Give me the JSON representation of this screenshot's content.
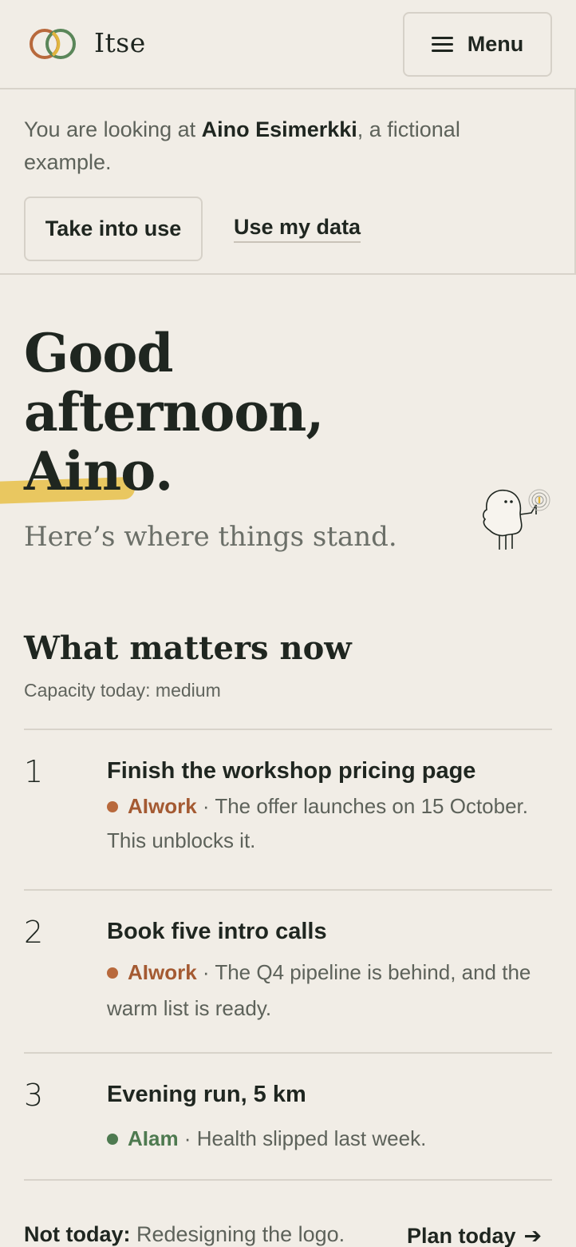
{
  "header": {
    "brand": "Itse",
    "menu_label": "Menu"
  },
  "banner": {
    "text_prefix": "You are looking at ",
    "person_name": "Aino Esimerkki",
    "text_suffix": ", a fictional example.",
    "take_into_use_label": "Take into use",
    "use_my_data_label": "Use my data"
  },
  "greeting": {
    "line1": "Good",
    "line2": "afternoon,",
    "name": "Aino",
    "punct": ".",
    "subtitle": "Here’s where things stand."
  },
  "priorities": {
    "title": "What matters now",
    "capacity": "Capacity today: medium",
    "items": [
      {
        "number": "1",
        "title": "Finish the workshop pricing page",
        "tag": "AIwork",
        "separator": " · ",
        "note": "The offer launches on 15 October. This unblocks it.",
        "color": "#a45a32"
      },
      {
        "number": "2",
        "title": "Book five intro calls",
        "tag": "AIwork",
        "separator": " · ",
        "note": "The Q4 pipeline is behind, and the warm list is ready.",
        "color": "#a45a32"
      },
      {
        "number": "3",
        "title": "Evening run, 5 km",
        "tag": "AIam",
        "separator": " · ",
        "note": "Health slipped last week.",
        "color": "#4e7a50"
      }
    ]
  },
  "footer": {
    "not_today_label": "Not today:",
    "not_today_text": " Redesigning the logo.",
    "plan_today_label": "Plan today"
  },
  "colors": {
    "background": "#f1ede6",
    "text": "#1f2620",
    "muted": "#5d625a",
    "work": "#a45a32",
    "iam": "#4e7a50",
    "highlight": "#e8c251"
  }
}
